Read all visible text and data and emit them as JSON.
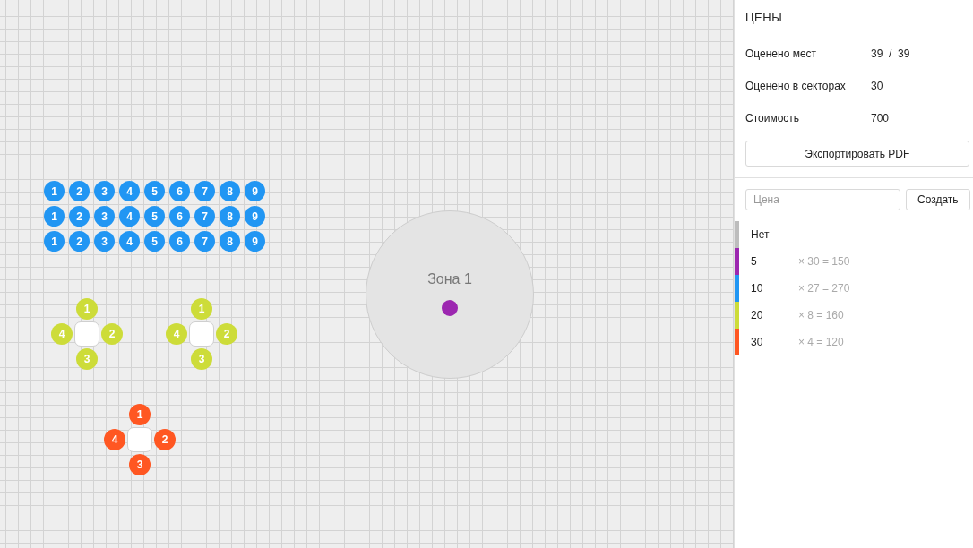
{
  "canvas": {
    "seat_rows": [
      {
        "color": "#2196f3",
        "seats": [
          "1",
          "2",
          "3",
          "4",
          "5",
          "6",
          "7",
          "8",
          "9"
        ]
      },
      {
        "color": "#2196f3",
        "seats": [
          "1",
          "2",
          "3",
          "4",
          "5",
          "6",
          "7",
          "8",
          "9"
        ]
      },
      {
        "color": "#2196f3",
        "seats": [
          "1",
          "2",
          "3",
          "4",
          "5",
          "6",
          "7",
          "8",
          "9"
        ]
      }
    ],
    "tables": [
      {
        "color": "#cddc39",
        "seats": [
          "1",
          "2",
          "3",
          "4"
        ]
      },
      {
        "color": "#cddc39",
        "seats": [
          "1",
          "2",
          "3",
          "4"
        ]
      },
      {
        "color": "#ff5722",
        "seats": [
          "1",
          "2",
          "3",
          "4"
        ]
      }
    ],
    "zones": [
      {
        "label": "Зона 1",
        "color": "#9c27b0"
      }
    ]
  },
  "sidebar": {
    "title": "ЦЕНЫ",
    "stats": [
      {
        "label": "Оценено мест",
        "value": "39  /  39"
      },
      {
        "label": "Оценено в секторах",
        "value": "30"
      },
      {
        "label": "Стоимость",
        "value": "700"
      }
    ],
    "export_button": "Экспортировать PDF",
    "price_field": {
      "placeholder": "Цена"
    },
    "create_button": "Создать",
    "prices": [
      {
        "label": "Нет",
        "color": "#bdbdbd"
      },
      {
        "label": "5",
        "detail": "× 30 = 150",
        "color": "#9c27b0"
      },
      {
        "label": "10",
        "detail": "× 27 = 270",
        "color": "#2196f3"
      },
      {
        "label": "20",
        "detail": "× 8 = 160",
        "color": "#cddc39"
      },
      {
        "label": "30",
        "detail": "× 4 = 120",
        "color": "#ff5722"
      }
    ]
  }
}
